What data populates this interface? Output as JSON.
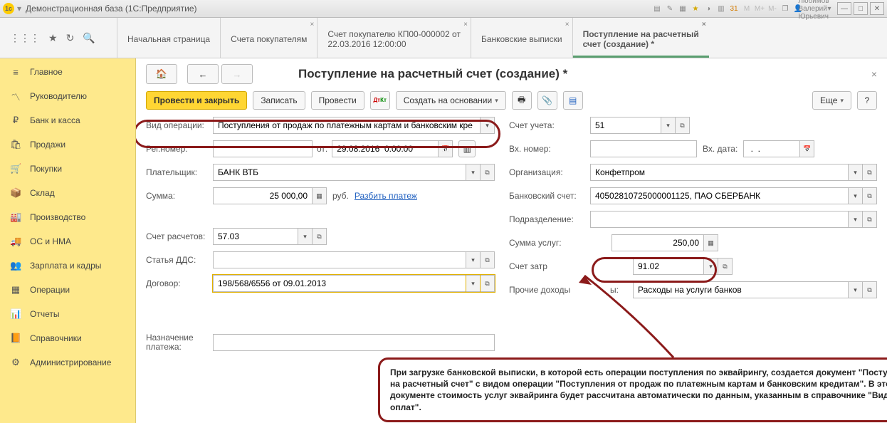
{
  "titlebar": {
    "app_title": "Демонстрационная база  (1С:Предприятие)",
    "user": "Любимов Валерий Юрьевич",
    "m1": "M",
    "m2": "M+",
    "m3": "M-"
  },
  "tabs": {
    "t0": "Начальная страница",
    "t1": "Счета покупателям",
    "t2_l1": "Счет покупателю КП00-000002 от",
    "t2_l2": "22.03.2016 12:00:00",
    "t3": "Банковские выписки",
    "t4_l1": "Поступление на расчетный",
    "t4_l2": "счет (создание) *"
  },
  "nav": {
    "n0": "Главное",
    "n1": "Руководителю",
    "n2": "Банк и касса",
    "n3": "Продажи",
    "n4": "Покупки",
    "n5": "Склад",
    "n6": "Производство",
    "n7": "ОС и НМА",
    "n8": "Зарплата и кадры",
    "n9": "Операции",
    "n10": "Отчеты",
    "n11": "Справочники",
    "n12": "Администрирование"
  },
  "page": {
    "title": "Поступление на расчетный счет (создание) *"
  },
  "toolbar": {
    "post_close": "Провести и закрыть",
    "save": "Записать",
    "post": "Провести",
    "create_based": "Создать на основании",
    "more": "Еще",
    "dk": "Дт Кт"
  },
  "left": {
    "vid_op_label": "Вид операции:",
    "vid_op_value": "Поступления от продаж по платежным картам и банковским кре",
    "regnum_label": "Рег.номер:",
    "ot_label": "от:",
    "date_value": "29.08.2016  0:00:00",
    "payer_label": "Плательщик:",
    "payer_value": "БАНК ВТБ",
    "sum_label": "Сумма:",
    "sum_value": "25 000,00",
    "rub": "руб.",
    "split_link": "Разбить платеж",
    "acct_label": "Счет расчетов:",
    "acct_value": "57.03",
    "dds_label": "Статья ДДС:",
    "contract_label": "Договор:",
    "contract_value": "198/568/6556 от 09.01.2013",
    "purpose_label": "Назначение платежа:"
  },
  "right": {
    "schet_label": "Счет учета:",
    "schet_value": "51",
    "vxnum_label": "Вх. номер:",
    "vxdate_label": "Вх. дата:",
    "vxdate_value": " .  .    ",
    "org_label": "Организация:",
    "org_value": "Конфетпром",
    "bank_label": "Банковский счет:",
    "bank_value": "40502810725000001125, ПАО СБЕРБАНК",
    "podr_label": "Подразделение:",
    "sumserv_label": "Сумма услуг:",
    "sumserv_value": "250,00",
    "szatr_label": "Счет затр",
    "szatr_value": "91.02",
    "prochie_label": "Прочие доходы",
    "prochie_tail": "ы:",
    "prochie_value": "Расходы на услуги банков"
  },
  "callout": {
    "text": "При загрузке банковской выписки, в которой есть операции поступления по эквайрингу, создается документ \"Поступление на расчетный счет\" с видом операции \"Поступления от продаж по платежным картам и банковским кредитам\". В этом документе стоимость услуг эквайринга будет рассчитана автоматически по данным, указанным в справочнике \"Виды оплат\"."
  }
}
